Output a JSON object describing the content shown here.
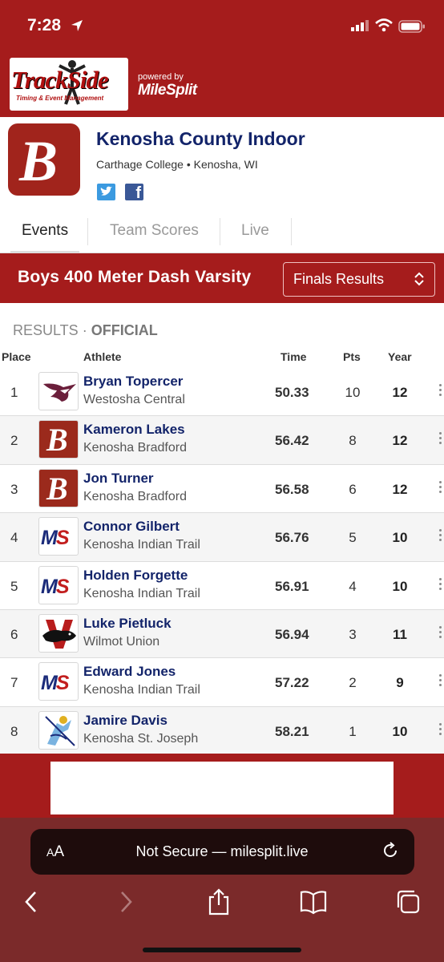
{
  "status_bar": {
    "time": "7:28"
  },
  "header": {
    "trackside_word": "TrackSide",
    "trackside_sub": "Timing & Event Management",
    "powered_by": "powered by",
    "milesplit": "MileSplit"
  },
  "meet": {
    "logo_letter": "B",
    "name": "Kenosha County Indoor",
    "location": "Carthage College • Kenosha, WI",
    "facebook_glyph": "f"
  },
  "tabs": [
    {
      "label": "Events",
      "active": true
    },
    {
      "label": "Team Scores",
      "active": false
    },
    {
      "label": "Live",
      "active": false
    }
  ],
  "event": {
    "title": "Boys 400 Meter Dash Varsity",
    "select_value": "Finals Results"
  },
  "results_header": {
    "prefix": "RESULTS",
    "separator": "·",
    "status": "OFFICIAL"
  },
  "columns": {
    "place": "Place",
    "athlete": "Athlete",
    "time": "Time",
    "pts": "Pts",
    "year": "Year"
  },
  "rows": [
    {
      "place": "1",
      "name": "Bryan Topercer",
      "team": "Westosha Central",
      "time": "50.33",
      "pts": "10",
      "year": "12",
      "logo": "hawk"
    },
    {
      "place": "2",
      "name": "Kameron Lakes",
      "team": "Kenosha Bradford",
      "time": "56.42",
      "pts": "8",
      "year": "12",
      "logo": "B"
    },
    {
      "place": "3",
      "name": "Jon Turner",
      "team": "Kenosha Bradford",
      "time": "56.58",
      "pts": "6",
      "year": "12",
      "logo": "B"
    },
    {
      "place": "4",
      "name": "Connor Gilbert",
      "team": "Kenosha Indian Trail",
      "time": "56.76",
      "pts": "5",
      "year": "10",
      "logo": "MS"
    },
    {
      "place": "5",
      "name": "Holden Forgette",
      "team": "Kenosha Indian Trail",
      "time": "56.91",
      "pts": "4",
      "year": "10",
      "logo": "MS"
    },
    {
      "place": "6",
      "name": "Luke Pietluck",
      "team": "Wilmot Union",
      "time": "56.94",
      "pts": "3",
      "year": "11",
      "logo": "panther"
    },
    {
      "place": "7",
      "name": "Edward Jones",
      "team": "Kenosha Indian Trail",
      "time": "57.22",
      "pts": "2",
      "year": "9",
      "logo": "MS"
    },
    {
      "place": "8",
      "name": "Jamire Davis",
      "team": "Kenosha St. Joseph",
      "time": "58.21",
      "pts": "1",
      "year": "10",
      "logo": "lancer"
    }
  ],
  "browser": {
    "aa_small": "A",
    "aa_large": "A",
    "url": "Not Secure — milesplit.live"
  },
  "colors": {
    "brand_red": "#a51c1c",
    "navy": "#13246a"
  }
}
